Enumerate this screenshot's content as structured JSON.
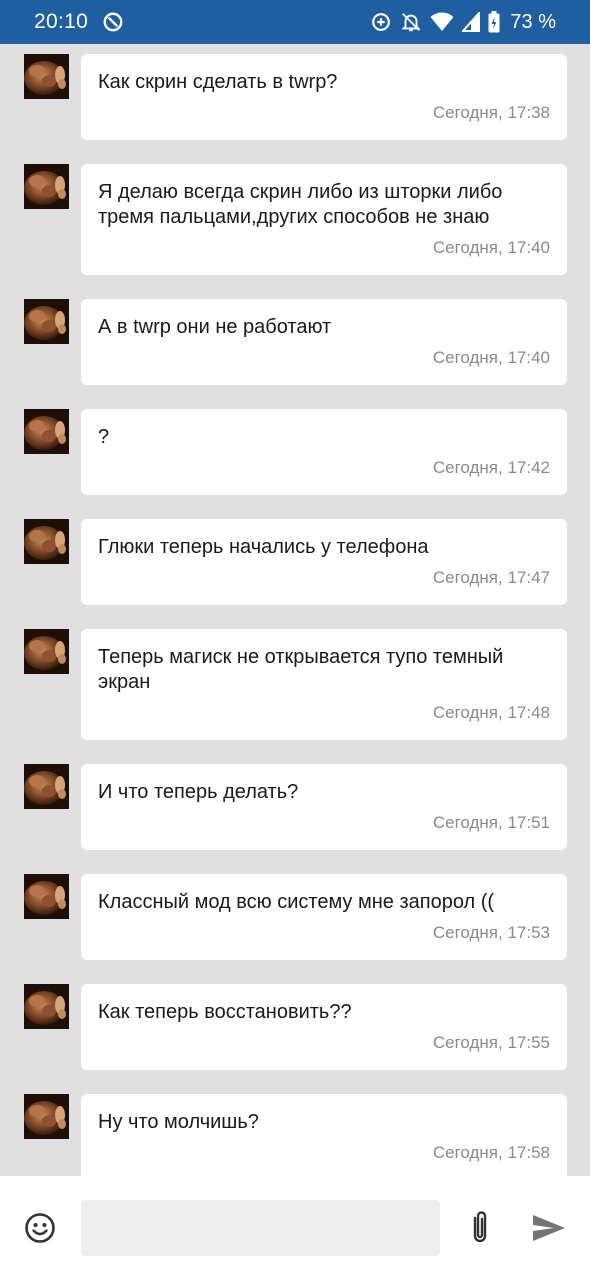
{
  "status_bar": {
    "time": "20:10",
    "battery": "73 %"
  },
  "messages": [
    {
      "text": "Как скрин сделать в twrp?",
      "time": "Сегодня, 17:38"
    },
    {
      "text": "Я делаю всегда скрин либо из шторки либо тремя пальцами,других способов не знаю",
      "time": "Сегодня, 17:40"
    },
    {
      "text": "А в twrp они не работают",
      "time": "Сегодня, 17:40"
    },
    {
      "text": "?",
      "time": "Сегодня, 17:42"
    },
    {
      "text": "Глюки теперь начались у телефона",
      "time": "Сегодня, 17:47"
    },
    {
      "text": "Теперь магиск не открывается тупо темный экран",
      "time": "Сегодня, 17:48"
    },
    {
      "text": "И что теперь делать?",
      "time": "Сегодня, 17:51"
    },
    {
      "text": "Классный мод всю систему мне запорол ((",
      "time": "Сегодня, 17:53"
    },
    {
      "text": "Как теперь восстановить??",
      "time": "Сегодня, 17:55"
    },
    {
      "text": "Ну что молчишь?",
      "time": "Сегодня, 17:58"
    }
  ],
  "input": {
    "value": "",
    "placeholder": ""
  },
  "icons": {
    "emoji": "emoji-icon",
    "attach": "paperclip-icon",
    "send": "send-icon"
  },
  "colors": {
    "status_bar": "#1f5e9f",
    "background": "#e0e0e0",
    "bubble": "#ffffff",
    "timestamp": "#8a8a8a"
  }
}
